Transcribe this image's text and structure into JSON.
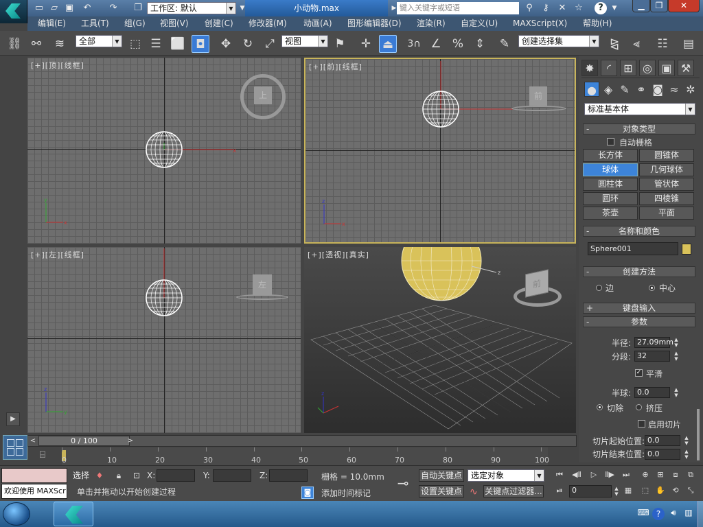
{
  "title_bar": {
    "workspace_label": "工作区: 默认",
    "file_name": "小动物.max",
    "search_placeholder": "键入关键字或短语"
  },
  "menu": [
    "编辑(E)",
    "工具(T)",
    "组(G)",
    "视图(V)",
    "创建(C)",
    "修改器(M)",
    "动画(A)",
    "图形编辑器(D)",
    "渲染(R)",
    "自定义(U)",
    "MAXScript(X)",
    "帮助(H)"
  ],
  "toolbar": {
    "selection_filter": "全部",
    "ref_coord": "视图",
    "snap_number": "3",
    "named_selection": "创建选择集"
  },
  "viewports": {
    "top": {
      "label": "[+][顶][线框]",
      "viewcube_face": "上"
    },
    "front": {
      "label": "[+][前][线框]",
      "viewcube_face": "前"
    },
    "left": {
      "label": "[+][左][线框]",
      "viewcube_face": "左"
    },
    "persp": {
      "label": "[+][透视][真实]",
      "viewcube_face": "前"
    }
  },
  "command_panel": {
    "category": "标准基本体",
    "object_type": {
      "header": "对象类型",
      "auto_grid": "自动栅格",
      "buttons": [
        "长方体",
        "圆锥体",
        "球体",
        "几何球体",
        "圆柱体",
        "管状体",
        "圆环",
        "四棱锥",
        "茶壶",
        "平面"
      ],
      "selected": "球体"
    },
    "name_color": {
      "header": "名称和颜色",
      "name": "Sphere001",
      "color": "#d9c25a"
    },
    "creation_method": {
      "header": "创建方法",
      "options": [
        "边",
        "中心"
      ],
      "selected": "中心"
    },
    "keyboard_entry": {
      "header": "键盘输入"
    },
    "parameters": {
      "header": "参数",
      "radius_label": "半径:",
      "radius": "27.09mm",
      "segments_label": "分段:",
      "segments": "32",
      "smooth_label": "平滑",
      "smooth": true,
      "hemisphere_label": "半球:",
      "hemisphere": "0.0",
      "chop_label": "切除",
      "squash_label": "挤压",
      "chop_mode": "切除",
      "slice_on_label": "启用切片",
      "slice_from_label": "切片起始位置:",
      "slice_from": "0.0",
      "slice_to_label": "切片结束位置:",
      "slice_to": "0.0"
    }
  },
  "timeline": {
    "frame_display": "0 / 100",
    "ticks": [
      "0",
      "10",
      "20",
      "30",
      "40",
      "50",
      "60",
      "70",
      "80",
      "90",
      "100"
    ]
  },
  "status": {
    "maxscript_text": "欢迎使用 MAXScr",
    "select_label": "选择",
    "x_label": "X:",
    "y_label": "Y:",
    "z_label": "Z:",
    "grid_text": "栅格 = 10.0mm",
    "prompt": "单击并拖动以开始创建过程",
    "add_time_tag": "添加时间标记",
    "auto_key": "自动关键点",
    "set_key": "设置关键点",
    "key_filter_dropdown": "选定对象",
    "key_filters": "关键点过滤器...",
    "current_frame": "0"
  },
  "colors": {
    "accent": "#3d84d9",
    "viewport_bg": "#6e6e6e",
    "active_border": "#c8b45a"
  }
}
